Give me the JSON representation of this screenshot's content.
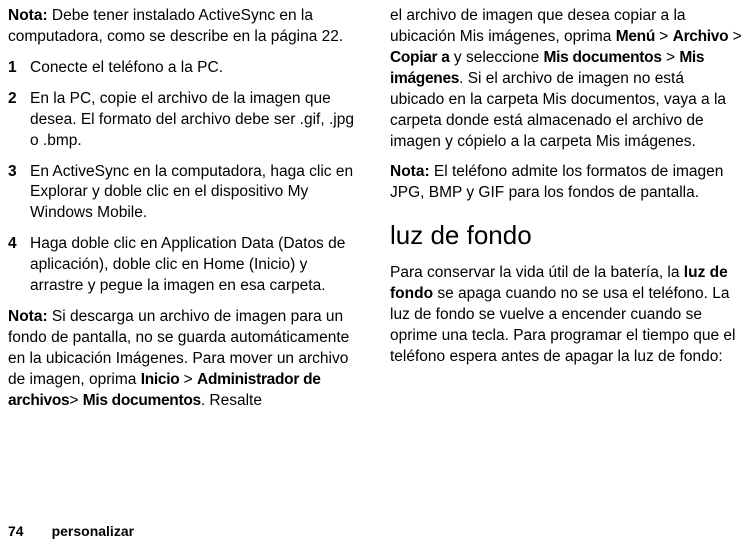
{
  "left": {
    "note1_label": "Nota:",
    "note1_text": " Debe tener instalado ActiveSync en la computadora, como se describe en la página 22.",
    "li1_num": "1",
    "li1": "Conecte el teléfono a la PC.",
    "li2_num": "2",
    "li2": "En la PC, copie el archivo de la imagen que desea. El formato del archivo debe ser .gif, .jpg o .bmp.",
    "li3_num": "3",
    "li3": "En ActiveSync en la computadora, haga clic en Explorar y doble clic en el dispositivo My Windows Mobile.",
    "li4_num": "4",
    "li4": "Haga doble clic en Application Data (Datos de aplicación), doble clic en Home (Inicio) y arrastre y pegue la imagen en esa carpeta.",
    "note2_label": "Nota:",
    "note2_a": " Si descarga un archivo de imagen para un fondo de pantalla, no se guarda automáticamente en la ubicación Imágenes. Para mover un archivo de imagen, oprima ",
    "inicio": "Inicio",
    "gt1": " > ",
    "adm": "Administrador de archivos",
    "gt2": "> ",
    "misdoc": "Mis documentos",
    "note2_b": ". Resalte"
  },
  "right": {
    "cont_a": "el archivo de imagen que desea copiar a la ubicación Mis imágenes, oprima ",
    "menu": "Menú",
    "gt3": " > ",
    "archivo": "Archivo",
    "gt4": " > ",
    "copiar": "Copiar a",
    "cont_b": " y seleccione ",
    "misdoc2": "Mis documentos",
    "gt5": " > ",
    "misimg": "Mis imágenes",
    "cont_c": ". Si el archivo de imagen no está ubicado en la carpeta Mis documentos, vaya a la carpeta donde está almacenado el archivo de imagen y cópielo a la carpeta Mis imágenes.",
    "note3_label": "Nota:",
    "note3_text": " El teléfono admite los formatos de imagen JPG, BMP y GIF para los fondos de pantalla.",
    "heading": "luz de fondo",
    "bl_a": "Para conservar la vida útil de la batería, la ",
    "bl_bold": "luz de fondo",
    "bl_b": " se apaga cuando no se usa el teléfono. La luz de fondo se vuelve a encender cuando se oprime una tecla. Para programar el tiempo que el teléfono espera antes de apagar la luz de fondo:"
  },
  "footer": {
    "page": "74",
    "section": "personalizar"
  }
}
